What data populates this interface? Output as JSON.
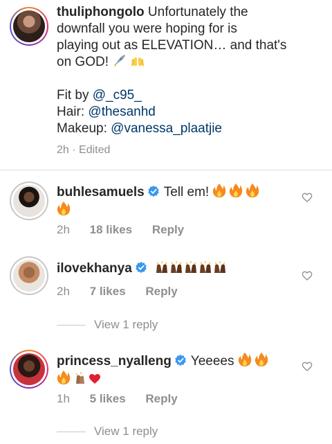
{
  "caption": {
    "username": "thuliphongolo",
    "text_line1": "Unfortunately the",
    "text_line2": "downfall you were hoping for is",
    "text_line3": "playing out as ELEVATION… and that's",
    "text_line4": "on GOD!",
    "fit_label": "Fit by",
    "fit_handle": "@_c95_",
    "hair_label": "Hair:",
    "hair_handle": "@thesanhd",
    "makeup_label": "Makeup:",
    "makeup_handle": "@vanessa_plaatjie",
    "meta": "2h · Edited"
  },
  "comments": [
    {
      "username": "buhlesamuels",
      "text": "Tell em!",
      "time": "2h",
      "likes": "18 likes",
      "reply": "Reply"
    },
    {
      "username": "ilovekhanya",
      "time": "2h",
      "likes": "7 likes",
      "reply": "Reply",
      "view_replies": "View 1 reply"
    },
    {
      "username": "princess_nyalleng",
      "text": "Yeeees",
      "time": "1h",
      "likes": "5 likes",
      "reply": "Reply",
      "view_replies": "View 1 reply"
    }
  ],
  "colors": {
    "verified_blue": "#3897f0",
    "mention": "#00376b",
    "meta_grey": "#8e8e8e",
    "heart_red": "#ed4956"
  }
}
